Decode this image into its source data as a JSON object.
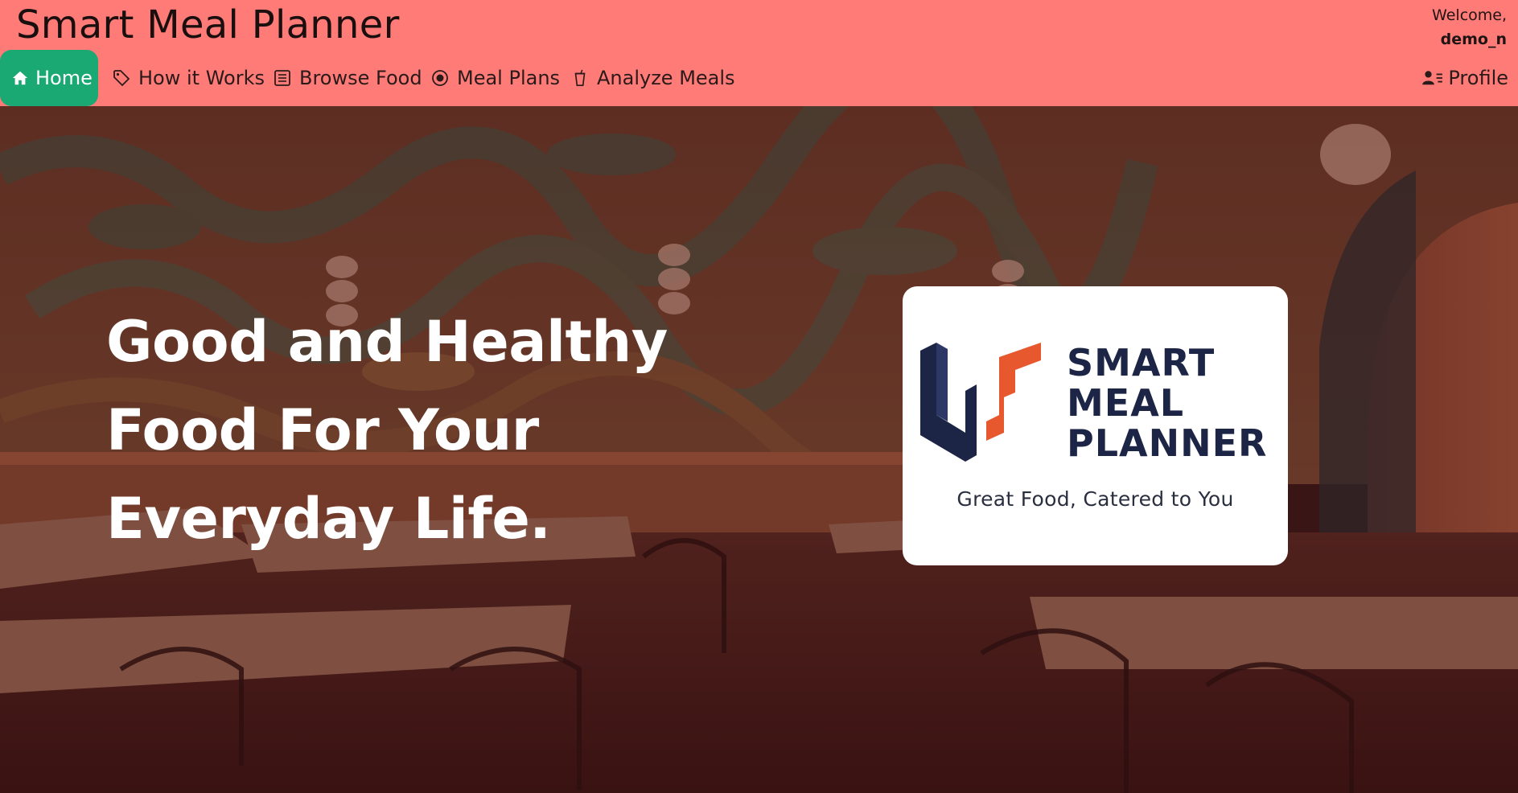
{
  "app": {
    "title": "Smart Meal Planner"
  },
  "user": {
    "welcome_label": "Welcome,",
    "username": "demo_n"
  },
  "nav": {
    "items": [
      {
        "label": "Home",
        "icon": "home-icon",
        "active": true
      },
      {
        "label": "How it Works",
        "icon": "tag-icon"
      },
      {
        "label": "Browse Food",
        "icon": "document-list-icon"
      },
      {
        "label": "Meal Plans",
        "icon": "target-icon"
      },
      {
        "label": "Analyze Meals",
        "icon": "cup-icon"
      }
    ],
    "profile_label": "Profile",
    "profile_icon": "user-list-icon"
  },
  "hero": {
    "headline_lines": [
      "Good and Healthy",
      "Food For Your",
      "Everyday Life."
    ]
  },
  "logo": {
    "line1": "SMART",
    "line2": "MEAL",
    "line3": "PLANNER",
    "tagline": "Great Food, Catered to You"
  },
  "colors": {
    "header_bg": "#ff7b77",
    "active_nav_bg": "#1aa873",
    "logo_navy": "#1d2547",
    "logo_orange": "#e8582e"
  }
}
